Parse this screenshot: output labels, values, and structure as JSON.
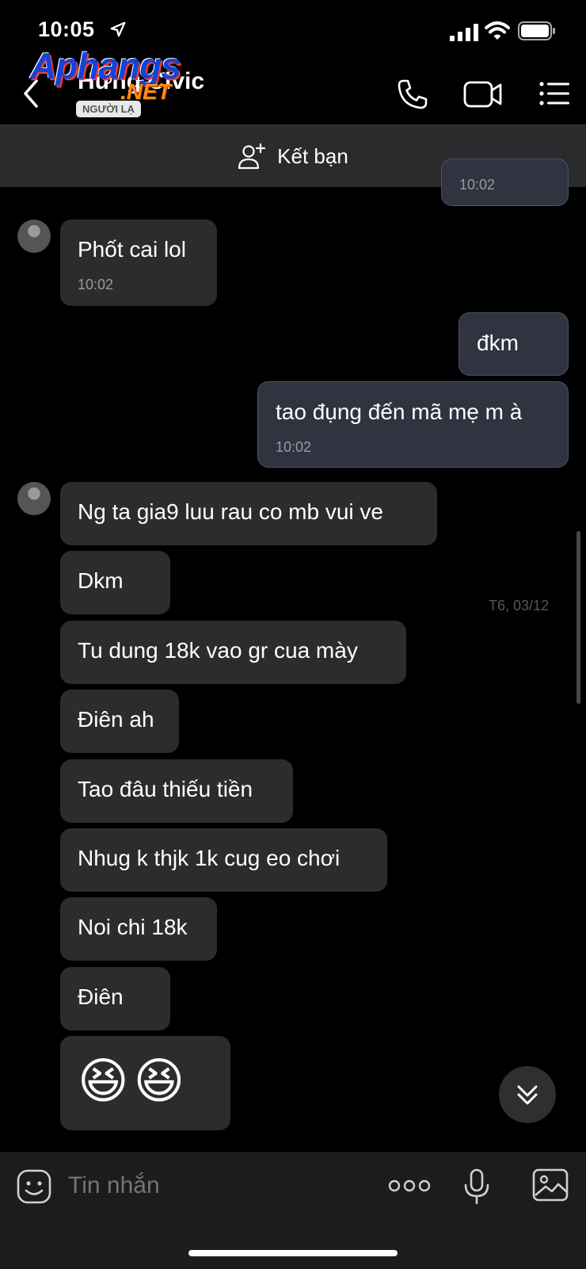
{
  "status_bar": {
    "time": "10:05"
  },
  "header": {
    "contact_name": "Hưng Civic",
    "badge": "NGƯỜI LẠ",
    "watermark_main": "Aphangs",
    "watermark_sub": ".NET"
  },
  "add_friend": {
    "label": "Kết bạn"
  },
  "messages": [
    {
      "dir": "out",
      "text": "",
      "time": "10:02"
    },
    {
      "dir": "in",
      "text": "Phốt cai lol",
      "time": "10:02"
    },
    {
      "dir": "out",
      "text": "đkm"
    },
    {
      "dir": "out",
      "text": "tao đụng đến mã mẹ m à",
      "time": "10:02"
    },
    {
      "dir": "in",
      "text": "Ng ta gia9 luu rau co mb vui ve"
    },
    {
      "dir": "in",
      "text": "Dkm"
    },
    {
      "dir": "in",
      "text": "Tu dung 18k vao gr cua mày"
    },
    {
      "dir": "in",
      "text": "Điên ah"
    },
    {
      "dir": "in",
      "text": "Tao đâu thiếu tiền"
    },
    {
      "dir": "in",
      "text": "Nhug k thjk 1k cug eo chơi"
    },
    {
      "dir": "in",
      "text": "Noi chi 18k"
    },
    {
      "dir": "in",
      "text": "Điên"
    },
    {
      "dir": "in",
      "emoji": "😆😆"
    }
  ],
  "date_separator": "T6, 03/12",
  "composer": {
    "placeholder": "Tin nhắn"
  },
  "colors": {
    "background": "#000000",
    "incoming_bubble": "#2c2c2e",
    "outgoing_bubble": "#2f3440",
    "header_bar": "#2b2b2d"
  }
}
